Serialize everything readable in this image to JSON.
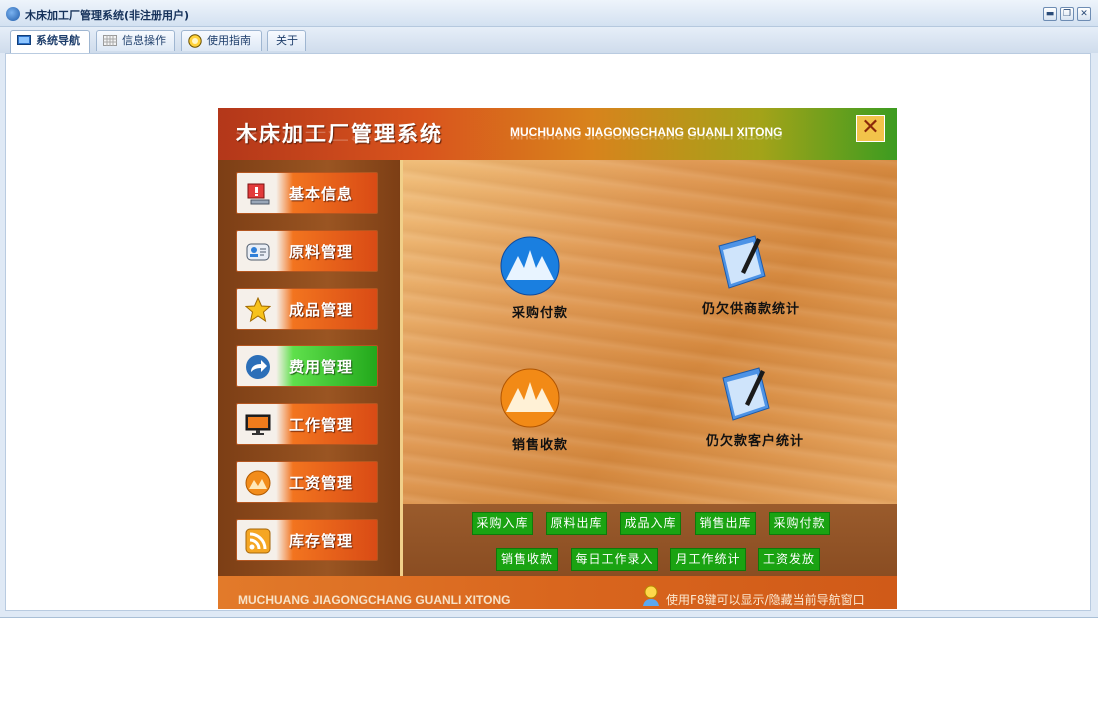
{
  "window": {
    "title": "木床加工厂管理系统(非注册用户)"
  },
  "tabs": [
    {
      "label": "系统导航"
    },
    {
      "label": "信息操作"
    },
    {
      "label": "使用指南"
    },
    {
      "label": "关于"
    }
  ],
  "panel": {
    "title": "木床加工厂管理系统",
    "subtitle": "MUCHUANG JIAGONGCHANG GUANLI XITONG",
    "close_label": "✕"
  },
  "sidebar": {
    "items": [
      {
        "label": "基本信息"
      },
      {
        "label": "原料管理"
      },
      {
        "label": "成品管理"
      },
      {
        "label": "费用管理"
      },
      {
        "label": "工作管理"
      },
      {
        "label": "工资管理"
      },
      {
        "label": "库存管理"
      }
    ]
  },
  "features": [
    {
      "label": "采购付款"
    },
    {
      "label": "仍欠供商款统计"
    },
    {
      "label": "销售收款"
    },
    {
      "label": "仍欠款客户统计"
    }
  ],
  "quick_buttons": {
    "row1": [
      "采购入库",
      "原料出库",
      "成品入库",
      "销售出库",
      "采购付款"
    ],
    "row2": [
      "销售收款",
      "每日工作录入",
      "月工作统计",
      "工资发放"
    ]
  },
  "footer": {
    "text": "MUCHUANG JIAGONGCHANG GUANLI XITONG",
    "hint": "使用F8键可以显示/隐藏当前导航窗口"
  }
}
